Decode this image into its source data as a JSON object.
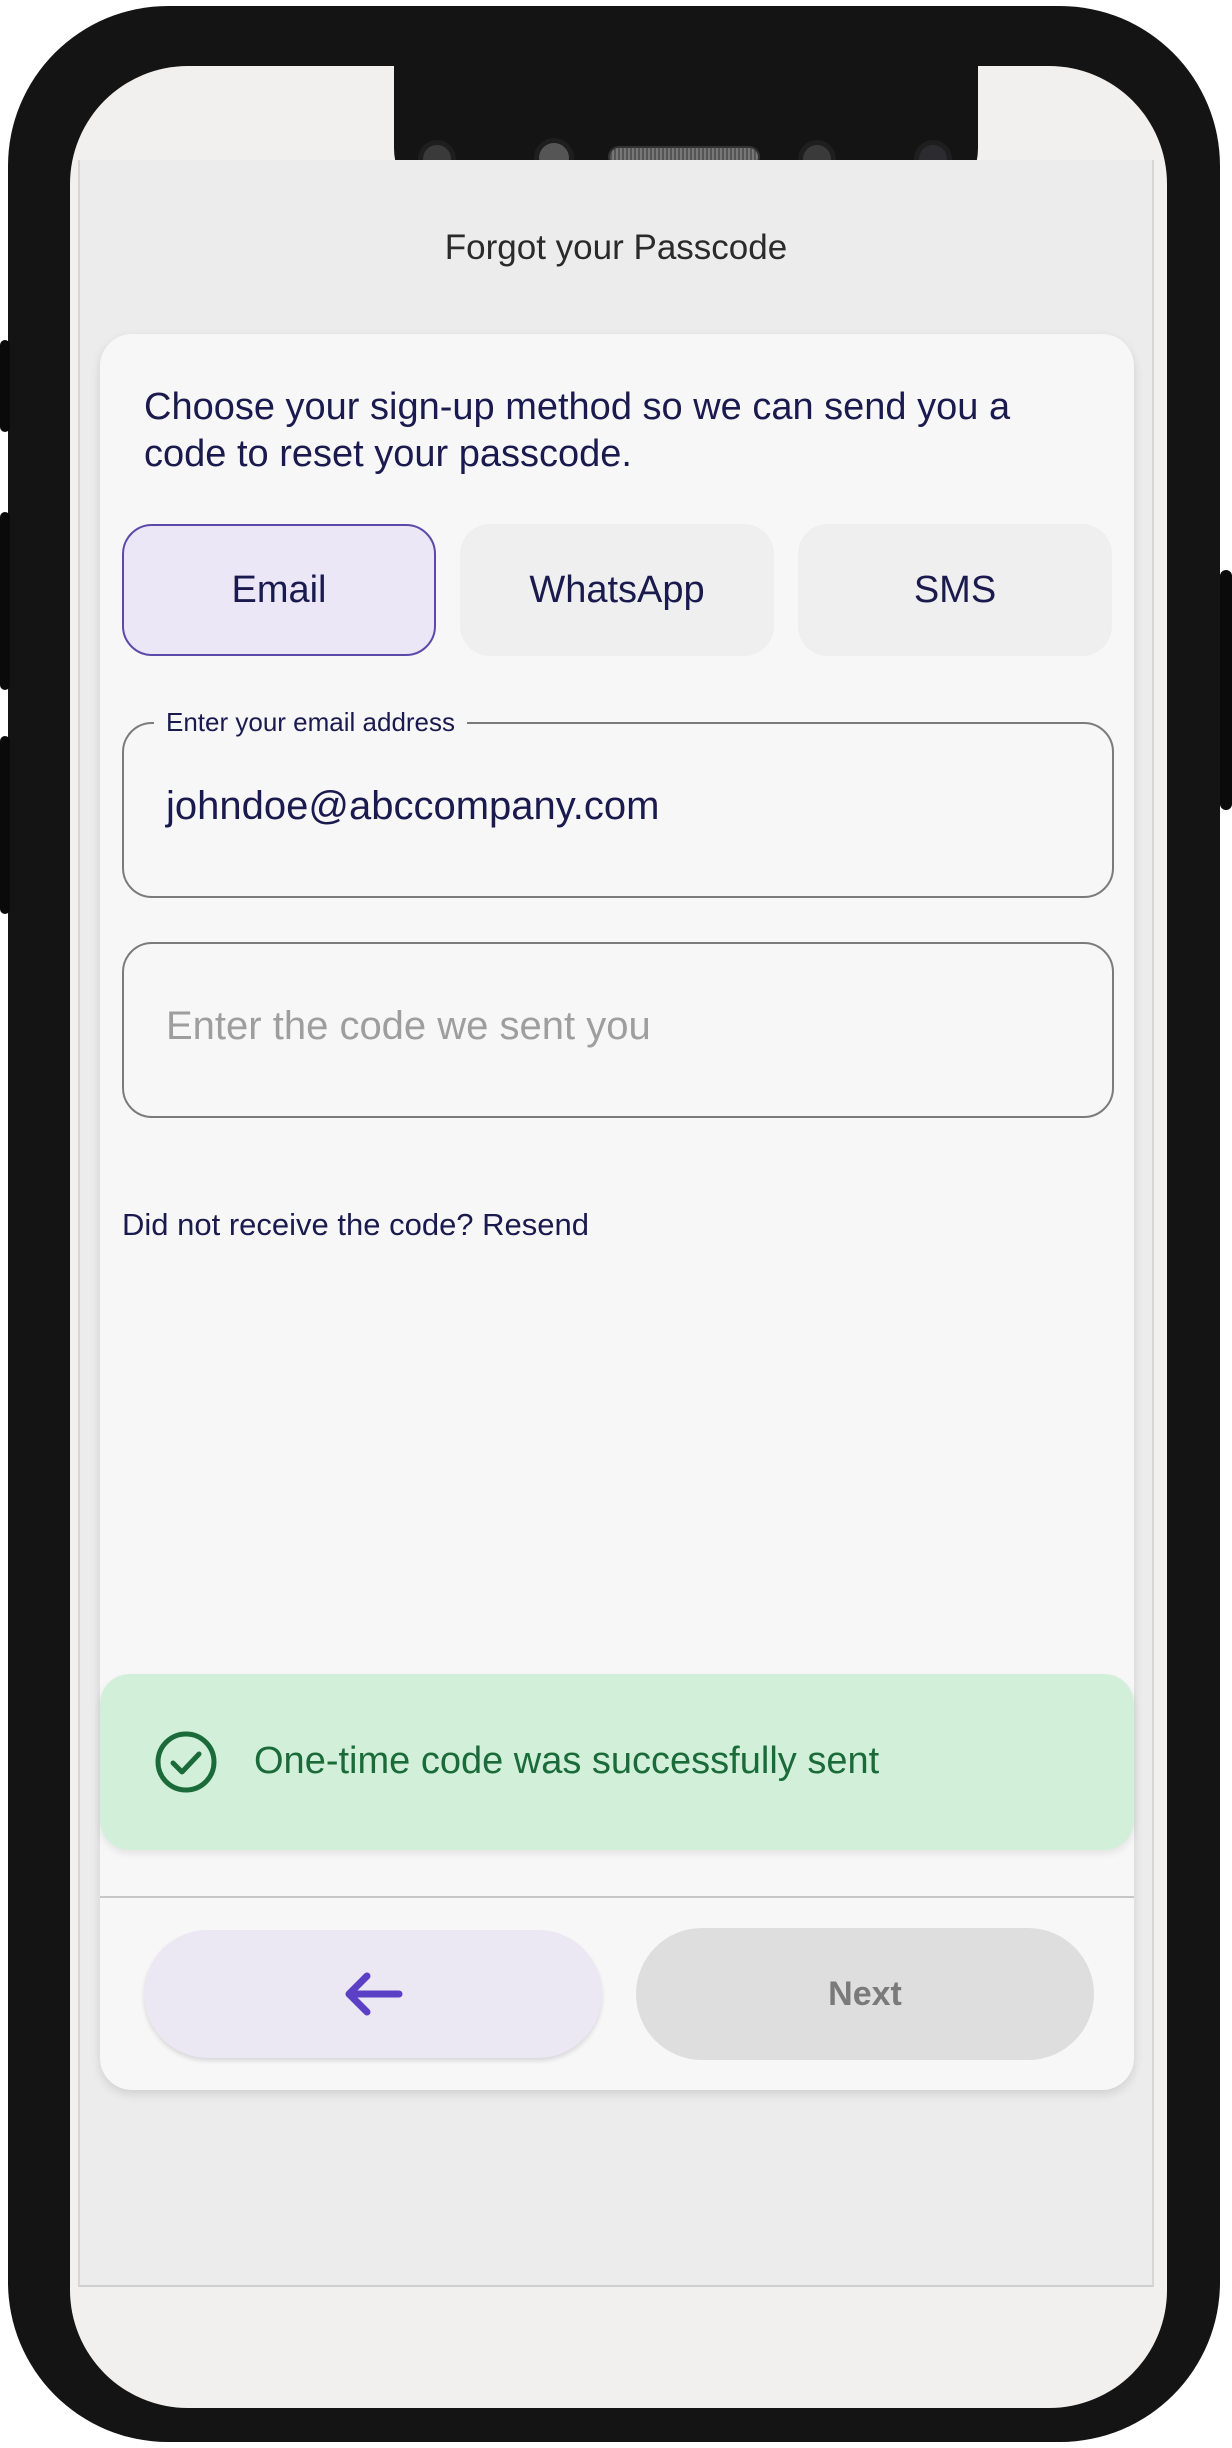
{
  "page": {
    "title": "Forgot your Passcode",
    "instructions": "Choose your sign-up method so we can send you a code to reset your passcode."
  },
  "methods": [
    {
      "label": "Email",
      "selected": true
    },
    {
      "label": "WhatsApp",
      "selected": false
    },
    {
      "label": "SMS",
      "selected": false
    }
  ],
  "email_field": {
    "label": "Enter your email address",
    "value": "johndoe@abccompany.com"
  },
  "code_field": {
    "placeholder": "Enter the code we sent you",
    "value": ""
  },
  "resend": {
    "text": "Did not receive the code? Resend"
  },
  "toast": {
    "message": "One-time code was successfully sent",
    "icon": "check-circle-icon"
  },
  "footer": {
    "back_icon": "arrow-left-icon",
    "next_label": "Next"
  },
  "colors": {
    "primary_text": "#1a1a4e",
    "accent": "#5b3fc4",
    "selected_bg": "#ebe7f6",
    "success_bg": "#d2f0d9",
    "success_text": "#1b6b3a"
  }
}
